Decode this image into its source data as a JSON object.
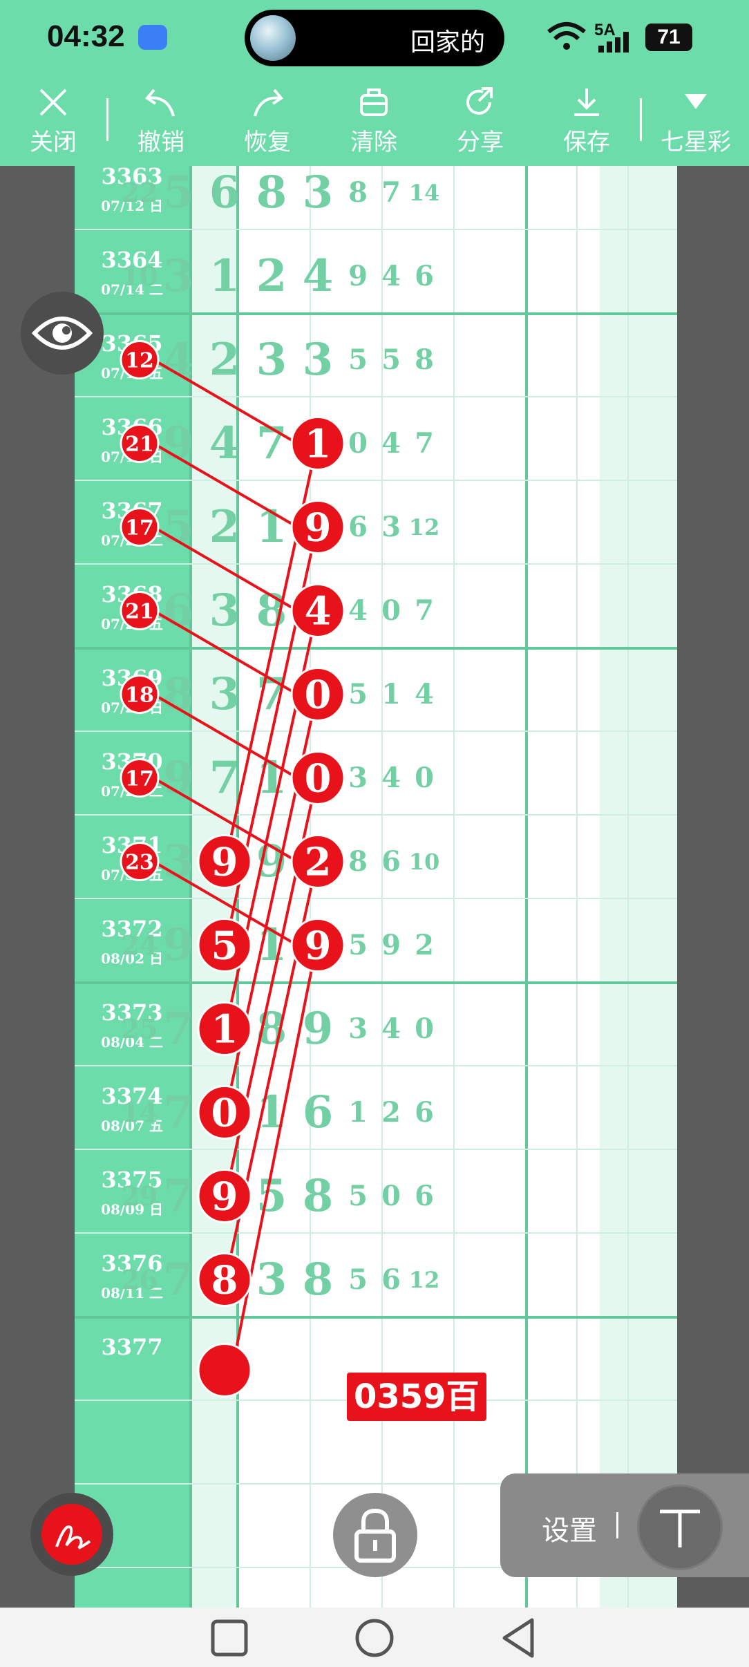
{
  "status_bar": {
    "time": "04:32",
    "island_text": "回家的",
    "network": "5A",
    "battery": "71"
  },
  "toolbar": {
    "items": [
      {
        "label": "关闭",
        "icon": "close-icon"
      },
      {
        "label": "撤销",
        "icon": "undo-icon"
      },
      {
        "label": "恢复",
        "icon": "redo-icon"
      },
      {
        "label": "清除",
        "icon": "clear-icon"
      },
      {
        "label": "分享",
        "icon": "share-icon"
      },
      {
        "label": "保存",
        "icon": "download-icon"
      },
      {
        "label": "七星彩",
        "icon": "dropdown-triangle-icon"
      }
    ]
  },
  "rows": [
    {
      "id": "3363",
      "date": "07/12 日",
      "sum": "22",
      "digits": [
        "5",
        "6",
        "8",
        "3"
      ],
      "side": [
        "8",
        "7",
        "14"
      ]
    },
    {
      "id": "3364",
      "date": "07/14 二",
      "sum": "10",
      "digits": [
        "3",
        "1",
        "2",
        "4"
      ],
      "side": [
        "9",
        "4",
        "6"
      ]
    },
    {
      "id": "3365",
      "date": "07/17 五",
      "sum": "12",
      "digits": [
        "4",
        "2",
        "3",
        "3"
      ],
      "side": [
        "5",
        "5",
        "8"
      ]
    },
    {
      "id": "3366",
      "date": "07/19 日",
      "sum": "21",
      "digits": [
        "9",
        "4",
        "7",
        "1"
      ],
      "side": [
        "0",
        "4",
        "7"
      ]
    },
    {
      "id": "3367",
      "date": "07/21 二",
      "sum": "17",
      "digits": [
        "5",
        "2",
        "1",
        "9"
      ],
      "side": [
        "6",
        "3",
        "12"
      ]
    },
    {
      "id": "3368",
      "date": "07/24 五",
      "sum": "21",
      "digits": [
        "6",
        "3",
        "8",
        "4"
      ],
      "side": [
        "4",
        "0",
        "7"
      ]
    },
    {
      "id": "3369",
      "date": "07/26 日",
      "sum": "18",
      "digits": [
        "8",
        "3",
        "7",
        "0"
      ],
      "side": [
        "5",
        "1",
        "4"
      ]
    },
    {
      "id": "3370",
      "date": "07/28 二",
      "sum": "17",
      "digits": [
        "9",
        "7",
        "1",
        "0"
      ],
      "side": [
        "3",
        "4",
        "0"
      ]
    },
    {
      "id": "3371",
      "date": "07/31 五",
      "sum": "23",
      "digits": [
        "3",
        "9",
        "9",
        "2"
      ],
      "side": [
        "8",
        "6",
        "10"
      ]
    },
    {
      "id": "3372",
      "date": "08/02 日",
      "sum": "24",
      "digits": [
        "9",
        "5",
        "1",
        "9"
      ],
      "side": [
        "5",
        "9",
        "2"
      ]
    },
    {
      "id": "3373",
      "date": "08/04 二",
      "sum": "25",
      "digits": [
        "7",
        "1",
        "8",
        "9"
      ],
      "side": [
        "3",
        "4",
        "0"
      ]
    },
    {
      "id": "3374",
      "date": "08/07 五",
      "sum": "14",
      "digits": [
        "7",
        "0",
        "1",
        "6"
      ],
      "side": [
        "1",
        "2",
        "6"
      ]
    },
    {
      "id": "3375",
      "date": "08/09 日",
      "sum": "29",
      "digits": [
        "7",
        "9",
        "5",
        "8"
      ],
      "side": [
        "5",
        "0",
        "6"
      ]
    },
    {
      "id": "3376",
      "date": "08/11 二",
      "sum": "26",
      "digits": [
        "7",
        "8",
        "3",
        "8"
      ],
      "side": [
        "5",
        "6",
        "12"
      ]
    },
    {
      "id": "3377",
      "date": "",
      "sum": "",
      "digits": [
        "",
        "",
        "",
        ""
      ],
      "side": [
        "",
        "",
        ""
      ]
    }
  ],
  "highlights": {
    "sum_rows": [
      2,
      3,
      4,
      5,
      6,
      7,
      8
    ],
    "col4_rows": [
      3,
      4,
      5,
      6,
      7,
      8,
      9
    ],
    "col2_rows": [
      8,
      9,
      10,
      11,
      12,
      13
    ],
    "color": "#e8121a"
  },
  "annotation": {
    "result_label": "0359百"
  },
  "overlay": {
    "settings_label": "设置"
  }
}
